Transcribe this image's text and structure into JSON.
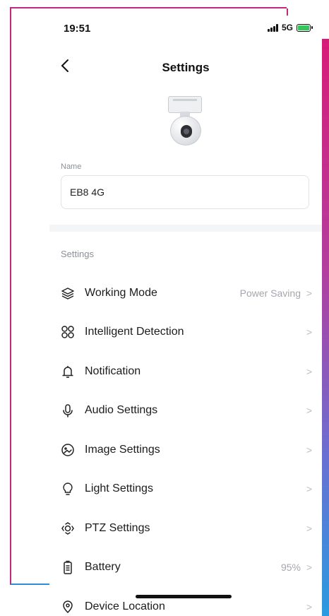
{
  "status_bar": {
    "time": "19:51",
    "network": "5G"
  },
  "header": {
    "title": "Settings"
  },
  "name_field": {
    "label": "Name",
    "value": "EB8 4G"
  },
  "settings_section": {
    "title": "Settings"
  },
  "items": [
    {
      "label": "Working Mode",
      "value": "Power Saving",
      "icon": "layers-icon"
    },
    {
      "label": "Intelligent Detection",
      "value": "",
      "icon": "grid-icon"
    },
    {
      "label": "Notification",
      "value": "",
      "icon": "bell-icon"
    },
    {
      "label": "Audio Settings",
      "value": "",
      "icon": "microphone-icon"
    },
    {
      "label": "Image Settings",
      "value": "",
      "icon": "image-icon"
    },
    {
      "label": "Light Settings",
      "value": "",
      "icon": "bulb-icon"
    },
    {
      "label": "PTZ Settings",
      "value": "",
      "icon": "ptz-icon"
    },
    {
      "label": "Battery",
      "value": "95%",
      "icon": "battery-icon"
    },
    {
      "label": "Device Location",
      "value": "",
      "icon": "location-icon"
    }
  ],
  "colors": {
    "accent_pink": "#d81b78",
    "accent_blue": "#2a9be0"
  }
}
